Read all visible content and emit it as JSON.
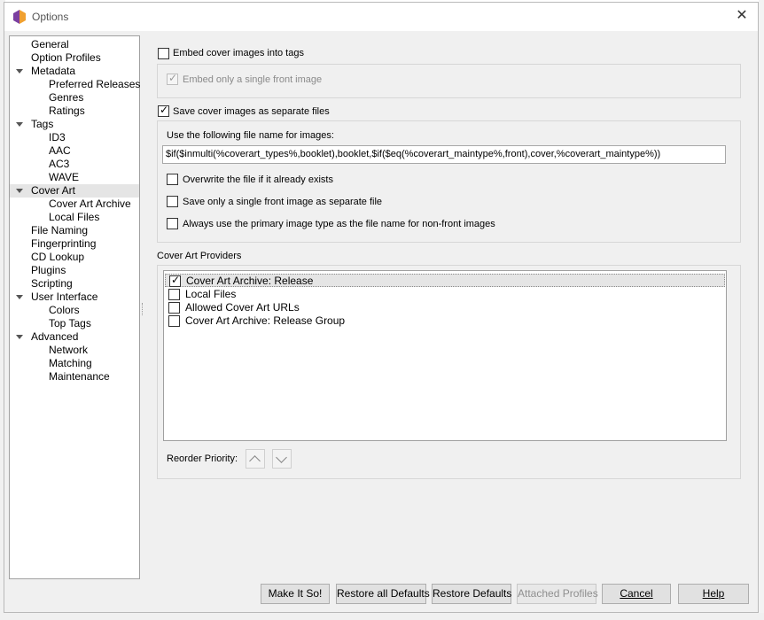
{
  "window": {
    "title": "Options"
  },
  "tree": {
    "items": [
      {
        "label": "General"
      },
      {
        "label": "Option Profiles"
      },
      {
        "label": "Metadata"
      },
      {
        "label": "Preferred Releases"
      },
      {
        "label": "Genres"
      },
      {
        "label": "Ratings"
      },
      {
        "label": "Tags"
      },
      {
        "label": "ID3"
      },
      {
        "label": "AAC"
      },
      {
        "label": "AC3"
      },
      {
        "label": "WAVE"
      },
      {
        "label": "Cover Art"
      },
      {
        "label": "Cover Art Archive"
      },
      {
        "label": "Local Files"
      },
      {
        "label": "File Naming"
      },
      {
        "label": "Fingerprinting"
      },
      {
        "label": "CD Lookup"
      },
      {
        "label": "Plugins"
      },
      {
        "label": "Scripting"
      },
      {
        "label": "User Interface"
      },
      {
        "label": "Colors"
      },
      {
        "label": "Top Tags"
      },
      {
        "label": "Advanced"
      },
      {
        "label": "Network"
      },
      {
        "label": "Matching"
      },
      {
        "label": "Maintenance"
      }
    ],
    "selected": "Cover Art"
  },
  "embed": {
    "label": "Embed cover images into tags",
    "checked": false,
    "single_front_label": "Embed only a single front image",
    "single_front_checked": true
  },
  "save": {
    "label": "Save cover images as separate files",
    "checked": true,
    "filename_label": "Use the following file name for images:",
    "filename_value": "$if($inmulti(%coverart_types%,booklet),booklet,$if($eq(%coverart_maintype%,front),cover,%coverart_maintype%))",
    "overwrite_label": "Overwrite the file if it already exists",
    "single_front_label": "Save only a single front image as separate file",
    "primary_type_label": "Always use the primary image type as the file name for non-front images"
  },
  "providers": {
    "title": "Cover Art Providers",
    "items": [
      {
        "label": "Cover Art Archive: Release",
        "checked": true
      },
      {
        "label": "Local Files",
        "checked": false
      },
      {
        "label": "Allowed Cover Art URLs",
        "checked": false
      },
      {
        "label": "Cover Art Archive: Release Group",
        "checked": false
      }
    ],
    "reorder_label": "Reorder Priority:"
  },
  "buttons": {
    "make_it_so": "Make It So!",
    "restore_all": "Restore all Defaults",
    "restore": "Restore Defaults",
    "attached_profiles": "Attached Profiles",
    "cancel": "Cancel",
    "help": "Help"
  }
}
